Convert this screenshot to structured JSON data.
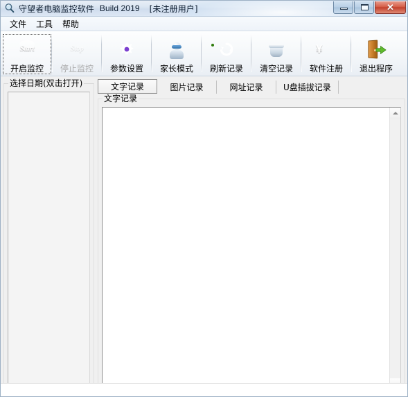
{
  "window": {
    "title_main": "守望者电脑监控软件",
    "title_build": "Build 2019",
    "title_registration": "[未注册用户]",
    "icon": "magnifier-app-icon",
    "controls": {
      "minimize": "minimize-button",
      "maximize": "maximize-button",
      "close_glyph": "✕"
    }
  },
  "menu": {
    "items": [
      {
        "label": "文件",
        "name": "menu-file"
      },
      {
        "label": "工具",
        "name": "menu-tools"
      },
      {
        "label": "帮助",
        "name": "menu-help"
      }
    ]
  },
  "toolbar": {
    "buttons": [
      {
        "label": "开启监控",
        "icon": "start-monitor-icon",
        "icon_text": "Start",
        "state": "selected",
        "name": "start-monitoring-button"
      },
      {
        "label": "停止监控",
        "icon": "stop-monitor-icon",
        "icon_text": "Stop",
        "state": "disabled",
        "name": "stop-monitoring-button"
      },
      {
        "label": "参数设置",
        "icon": "gear-icon",
        "state": "normal",
        "name": "settings-button"
      },
      {
        "label": "家长模式",
        "icon": "parent-mode-icon",
        "state": "normal",
        "name": "parent-mode-button"
      },
      {
        "label": "刷新记录",
        "icon": "refresh-icon",
        "state": "normal",
        "name": "refresh-records-button"
      },
      {
        "label": "清空记录",
        "icon": "trash-icon",
        "state": "normal",
        "name": "clear-records-button"
      },
      {
        "label": "软件注册",
        "icon": "yen-register-icon",
        "icon_text": "¥",
        "state": "normal",
        "name": "register-software-button"
      },
      {
        "label": "退出程序",
        "icon": "exit-door-icon",
        "state": "normal",
        "name": "exit-program-button"
      }
    ]
  },
  "date_panel": {
    "legend": "选择日期(双击打开)",
    "items": []
  },
  "tabs": [
    {
      "label": "文字记录",
      "name": "tab-text-records",
      "active": true
    },
    {
      "label": "图片记录",
      "name": "tab-image-records",
      "active": false
    },
    {
      "label": "网址记录",
      "name": "tab-url-records",
      "active": false
    },
    {
      "label": "U盘插拔记录",
      "name": "tab-usb-records",
      "active": false
    }
  ],
  "records": {
    "legend": "文字记录",
    "content": "",
    "scroll": {
      "up_arrow": "▲",
      "down_arrow": "▼"
    }
  },
  "colors": {
    "title_bar_start": "#e8eef6",
    "title_bar_end": "#dce7f4",
    "window_bg": "#f0f0f0",
    "close_button": "#c2402c",
    "accent_green": "#4bbf2e",
    "accent_purple": "#7b3fd0"
  }
}
